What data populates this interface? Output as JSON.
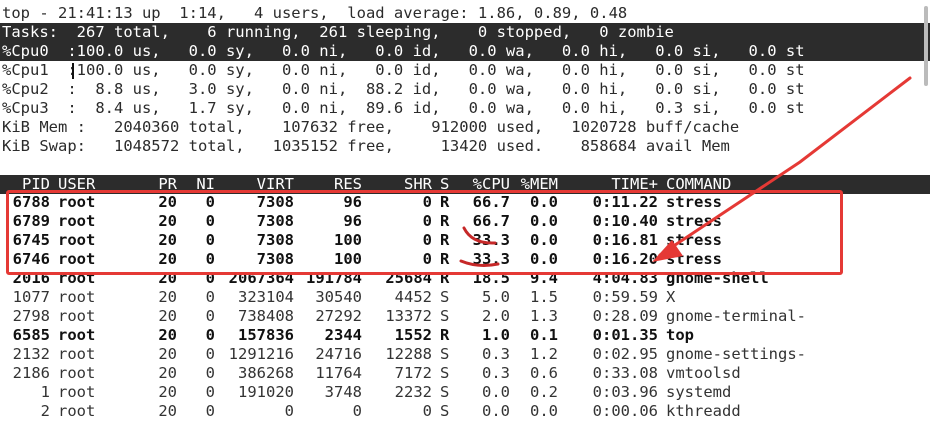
{
  "header": {
    "uptime_line": "top - 21:41:13 up  1:14,   4 users,  load average: 1.86, 0.89, 0.48",
    "tasks_line": "Tasks:  267 total,    6 running,  261 sleeping,    0 stopped,   0 zombie",
    "cpu_lines": [
      "%Cpu0  :100.0 us,   0.0 sy,   0.0 ni,   0.0 id,   0.0 wa,   0.0 hi,   0.0 si,   0.0 st",
      "%Cpu1  :100.0 us,   0.0 sy,   0.0 ni,   0.0 id,   0.0 wa,   0.0 hi,   0.0 si,   0.0 st",
      "%Cpu2  :  8.8 us,   3.0 sy,   0.0 ni,  88.2 id,   0.0 wa,   0.0 hi,   0.0 si,   0.0 st",
      "%Cpu3  :  8.4 us,   1.7 sy,   0.0 ni,  89.6 id,   0.0 wa,   0.0 hi,   0.3 si,   0.0 st"
    ],
    "mem_line": "KiB Mem :   2040360 total,    107632 free,    912000 used,   1020728 buff/cache",
    "swap_line": "KiB Swap:   1048572 total,   1035152 free,     13420 used.    858684 avail Mem"
  },
  "columns": [
    "PID",
    "USER",
    "PR",
    "NI",
    "VIRT",
    "RES",
    "SHR",
    "S",
    "%CPU",
    "%MEM",
    "TIME+",
    "COMMAND"
  ],
  "processes": [
    {
      "pid": "6788",
      "user": "root",
      "pr": "20",
      "ni": "0",
      "virt": "7308",
      "res": "96",
      "shr": "0",
      "s": "R",
      "cpu": "66.7",
      "mem": "0.0",
      "time": "0:11.22",
      "cmd": "stress",
      "bold": true
    },
    {
      "pid": "6789",
      "user": "root",
      "pr": "20",
      "ni": "0",
      "virt": "7308",
      "res": "96",
      "shr": "0",
      "s": "R",
      "cpu": "66.7",
      "mem": "0.0",
      "time": "0:10.40",
      "cmd": "stress",
      "bold": true
    },
    {
      "pid": "6745",
      "user": "root",
      "pr": "20",
      "ni": "0",
      "virt": "7308",
      "res": "100",
      "shr": "0",
      "s": "R",
      "cpu": "33.3",
      "mem": "0.0",
      "time": "0:16.81",
      "cmd": "stress",
      "bold": true
    },
    {
      "pid": "6746",
      "user": "root",
      "pr": "20",
      "ni": "0",
      "virt": "7308",
      "res": "100",
      "shr": "0",
      "s": "R",
      "cpu": "33.3",
      "mem": "0.0",
      "time": "0:16.20",
      "cmd": "stress",
      "bold": true
    },
    {
      "pid": "2016",
      "user": "root",
      "pr": "20",
      "ni": "0",
      "virt": "2067364",
      "res": "191784",
      "shr": "25684",
      "s": "R",
      "cpu": "18.5",
      "mem": "9.4",
      "time": "4:04.83",
      "cmd": "gnome-shell",
      "bold": true
    },
    {
      "pid": "1077",
      "user": "root",
      "pr": "20",
      "ni": "0",
      "virt": "323104",
      "res": "30540",
      "shr": "4452",
      "s": "S",
      "cpu": "5.0",
      "mem": "1.5",
      "time": "0:59.59",
      "cmd": "X",
      "bold": false
    },
    {
      "pid": "2798",
      "user": "root",
      "pr": "20",
      "ni": "0",
      "virt": "738408",
      "res": "27292",
      "shr": "13372",
      "s": "S",
      "cpu": "2.0",
      "mem": "1.3",
      "time": "0:28.09",
      "cmd": "gnome-terminal-",
      "bold": false
    },
    {
      "pid": "6585",
      "user": "root",
      "pr": "20",
      "ni": "0",
      "virt": "157836",
      "res": "2344",
      "shr": "1552",
      "s": "R",
      "cpu": "1.0",
      "mem": "0.1",
      "time": "0:01.35",
      "cmd": "top",
      "bold": true
    },
    {
      "pid": "2132",
      "user": "root",
      "pr": "20",
      "ni": "0",
      "virt": "1291216",
      "res": "24716",
      "shr": "12288",
      "s": "S",
      "cpu": "0.3",
      "mem": "1.2",
      "time": "0:02.95",
      "cmd": "gnome-settings-",
      "bold": false
    },
    {
      "pid": "2186",
      "user": "root",
      "pr": "20",
      "ni": "0",
      "virt": "386268",
      "res": "11764",
      "shr": "7172",
      "s": "S",
      "cpu": "0.3",
      "mem": "0.6",
      "time": "0:33.08",
      "cmd": "vmtoolsd",
      "bold": false
    },
    {
      "pid": "1",
      "user": "root",
      "pr": "20",
      "ni": "0",
      "virt": "191020",
      "res": "3748",
      "shr": "2232",
      "s": "S",
      "cpu": "0.0",
      "mem": "0.2",
      "time": "0:03.96",
      "cmd": "systemd",
      "bold": false
    },
    {
      "pid": "2",
      "user": "root",
      "pr": "20",
      "ni": "0",
      "virt": "0",
      "res": "0",
      "shr": "0",
      "s": "S",
      "cpu": "0.0",
      "mem": "0.0",
      "time": "0:00.06",
      "cmd": "kthreadd",
      "bold": false
    }
  ],
  "annotation_color": "#e53935"
}
